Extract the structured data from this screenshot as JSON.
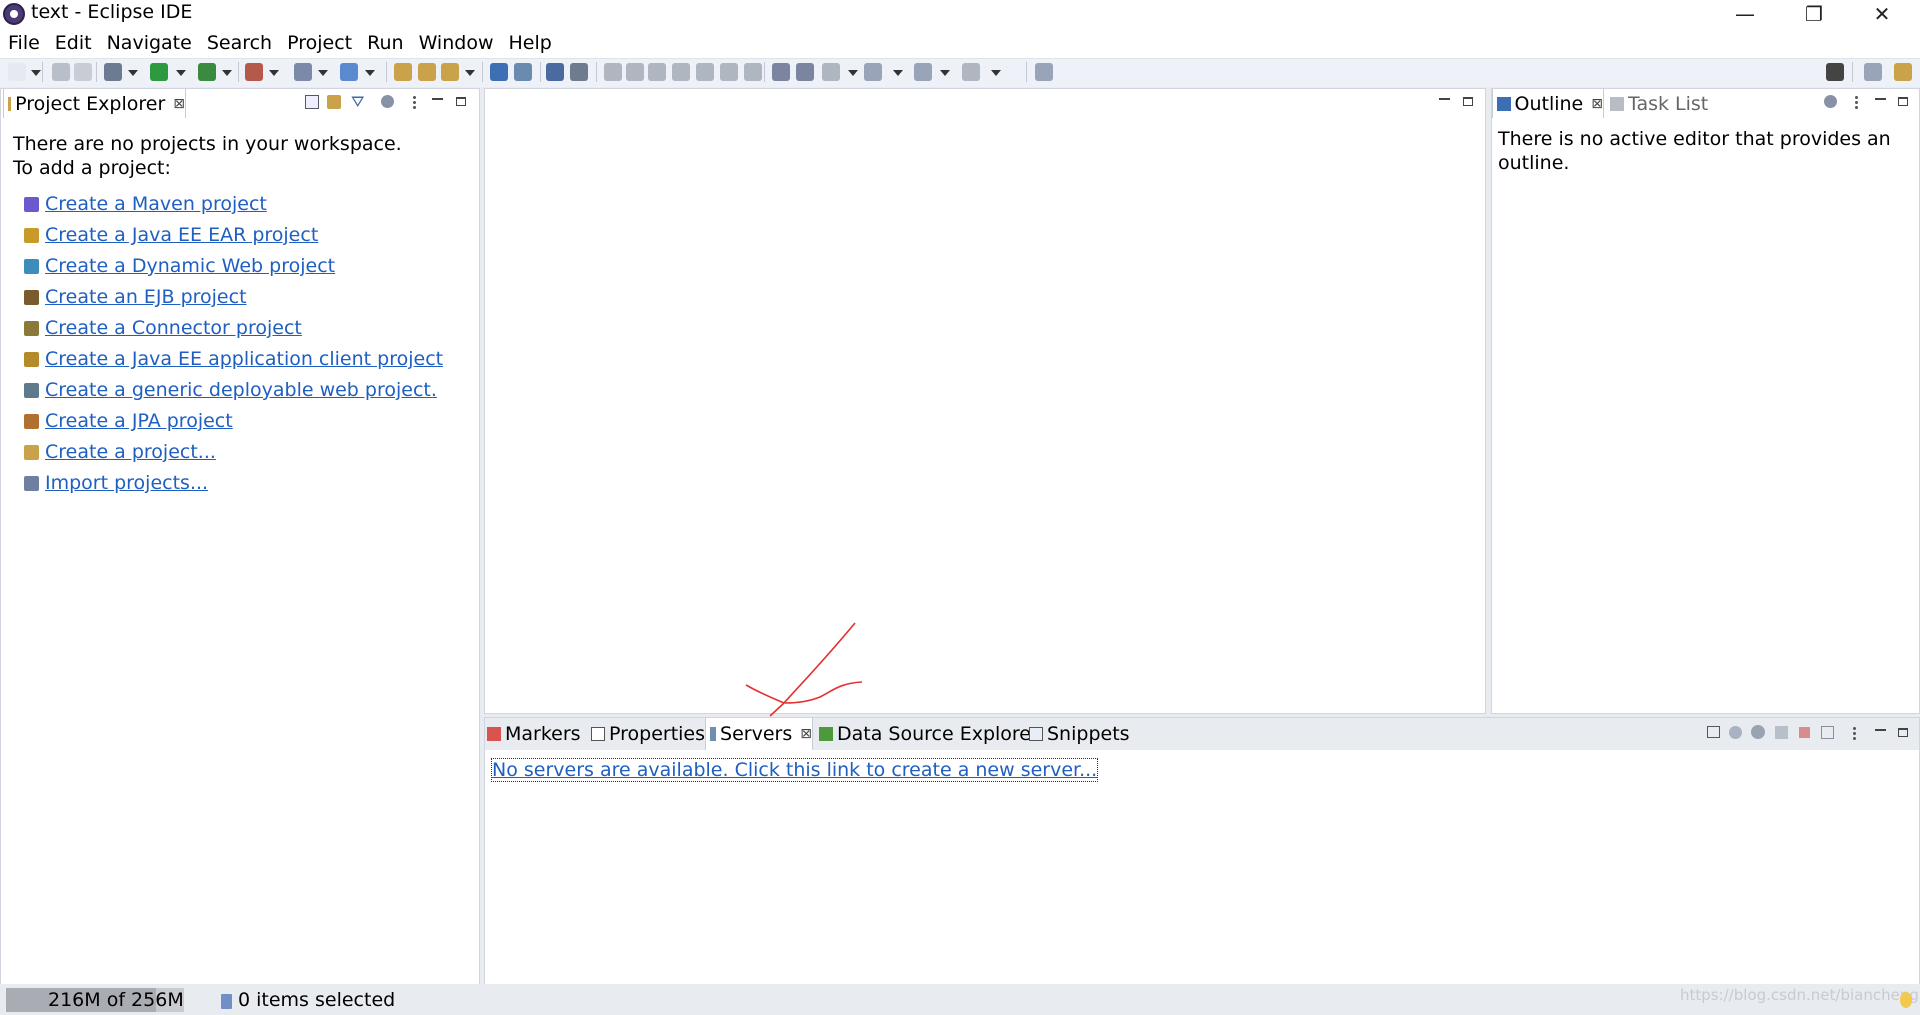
{
  "window": {
    "title": "text - Eclipse IDE",
    "controls": {
      "minimize": "—",
      "restore": "❐",
      "close": "✕"
    }
  },
  "menu": [
    "File",
    "Edit",
    "Navigate",
    "Search",
    "Project",
    "Run",
    "Window",
    "Help"
  ],
  "project_explorer": {
    "tab_label": "Project Explorer",
    "empty_line1": "There are no projects in your workspace.",
    "empty_line2": "To add a project:",
    "links": [
      {
        "label": "Create a Maven project",
        "icon": "maven-project-icon",
        "color": "#6a5acd"
      },
      {
        "label": "Create a Java EE EAR project",
        "icon": "ear-project-icon",
        "color": "#c79a2a"
      },
      {
        "label": "Create a Dynamic Web project",
        "icon": "web-project-icon",
        "color": "#3c8dbc"
      },
      {
        "label": "Create an EJB project",
        "icon": "ejb-project-icon",
        "color": "#7a5b2e"
      },
      {
        "label": "Create a Connector project",
        "icon": "connector-project-icon",
        "color": "#8a7a3a"
      },
      {
        "label": "Create a Java EE application client project",
        "icon": "appclient-project-icon",
        "color": "#b58b2a"
      },
      {
        "label": "Create a generic deployable web project.",
        "icon": "generic-web-project-icon",
        "color": "#5f7a8a"
      },
      {
        "label": "Create a JPA project",
        "icon": "jpa-project-icon",
        "color": "#b07030"
      },
      {
        "label": "Create a project...",
        "icon": "new-project-icon",
        "color": "#c9a24a"
      },
      {
        "label": "Import projects...",
        "icon": "import-projects-icon",
        "color": "#6f7f9f"
      }
    ]
  },
  "outline": {
    "tab_label": "Outline",
    "tab2_label": "Task List",
    "message_line1": "There is no active editor that provides an",
    "message_line2": "outline."
  },
  "bottom_panel": {
    "tabs": [
      "Markers",
      "Properties",
      "Servers",
      "Data Source Explorer",
      "Snippets"
    ],
    "active_tab": "Servers",
    "servers_link": "No servers are available. Click this link to create a new server..."
  },
  "status_bar": {
    "heap": "216M of 256M",
    "heap_fraction": 0.84,
    "selection": "0 items selected",
    "watermark": "https://blog.csdn.net/biancheng"
  },
  "colors": {
    "link": "#1e5fc1",
    "annotation": "#e53030",
    "workbench_bg": "#e8ebf0"
  }
}
